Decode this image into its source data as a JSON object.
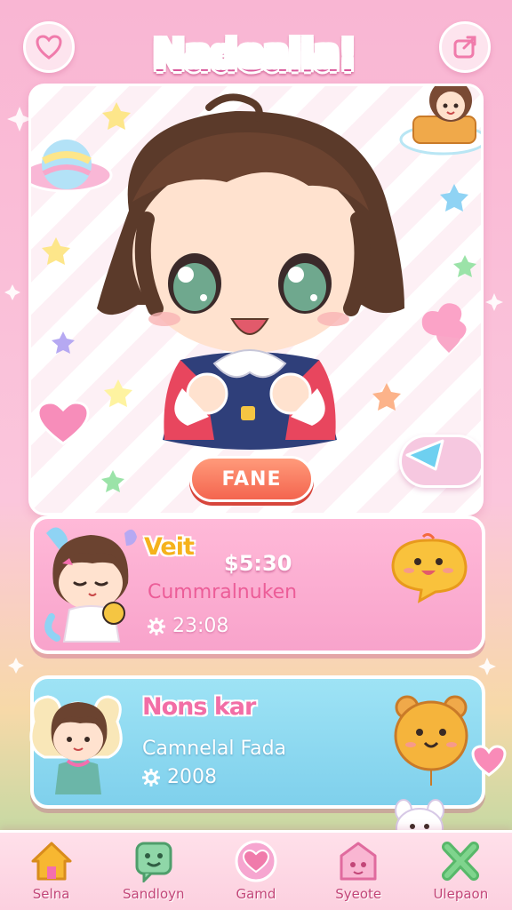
{
  "header": {
    "title": "Nadeaiia!",
    "left_button_icon": "heart-icon",
    "right_button_icon": "share-icon"
  },
  "hero": {
    "action_button_label": "FANE",
    "play_button_icon": "play-icon"
  },
  "cards": [
    {
      "name": "Veit",
      "price": "$5:30",
      "subtitle": "Cummralnuken",
      "stat_icon": "gear-icon",
      "stat_value": "23:08",
      "mascot_icon": "chat-bubble-mascot-icon",
      "color": "#f8a3cb"
    },
    {
      "name": "Nons kar",
      "subtitle": "Camnelal Fada",
      "stat_icon": "gear-icon",
      "stat_value": "2008",
      "mascot_icon": "bear-balloon-mascot-icon",
      "color": "#7fd0ec"
    }
  ],
  "bottom_nav": [
    {
      "label": "Selna",
      "icon": "home-icon"
    },
    {
      "label": "Sandloyn",
      "icon": "chat-icon"
    },
    {
      "label": "Gamd",
      "icon": "heart-icon"
    },
    {
      "label": "Syeote",
      "icon": "shop-icon"
    },
    {
      "label": "Ulepaon",
      "icon": "close-icon"
    }
  ],
  "colors": {
    "background": "#fbc6dc",
    "accent_pink": "#f46fae",
    "accent_orange": "#f4654f",
    "accent_blue": "#7fd0ec",
    "accent_yellow": "#f5b21c"
  }
}
